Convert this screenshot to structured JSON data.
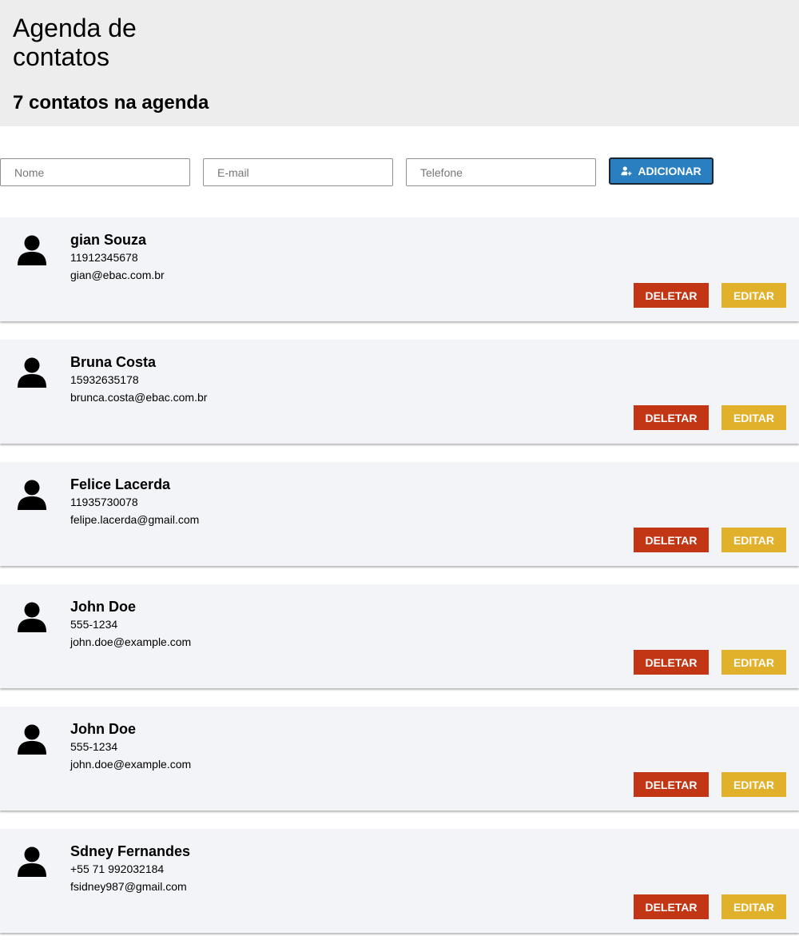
{
  "header": {
    "title": "Agenda de contatos",
    "count_text": "7 contatos na agenda"
  },
  "form": {
    "name_placeholder": "Nome",
    "email_placeholder": "E-mail",
    "phone_placeholder": "Telefone",
    "add_label": "ADICIONAR",
    "add_icon": "add-user-icon"
  },
  "colors": {
    "header_bg": "#ededed",
    "card_bg": "#f3f4f8",
    "add_button": "#2a7fc1",
    "delete_button": "#c23616",
    "edit_button": "#e1b12c"
  },
  "contacts": [
    {
      "name": "gian Souza",
      "phone": "11912345678",
      "email": "gian@ebac.com.br",
      "delete_label": "DELETAR",
      "edit_label": "EDITAR"
    },
    {
      "name": "Bruna Costa",
      "phone": "15932635178",
      "email": "brunca.costa@ebac.com.br",
      "delete_label": "DELETAR",
      "edit_label": "EDITAR"
    },
    {
      "name": "Felice Lacerda",
      "phone": "11935730078",
      "email": "felipe.lacerda@gmail.com",
      "delete_label": "DELETAR",
      "edit_label": "EDITAR"
    },
    {
      "name": "John Doe",
      "phone": "555-1234",
      "email": "john.doe@example.com",
      "delete_label": "DELETAR",
      "edit_label": "EDITAR"
    },
    {
      "name": "John Doe",
      "phone": "555-1234",
      "email": "john.doe@example.com",
      "delete_label": "DELETAR",
      "edit_label": "EDITAR"
    },
    {
      "name": "Sdney Fernandes",
      "phone": "+55 71 992032184",
      "email": "fsidney987@gmail.com",
      "delete_label": "DELETAR",
      "edit_label": "EDITAR"
    }
  ]
}
